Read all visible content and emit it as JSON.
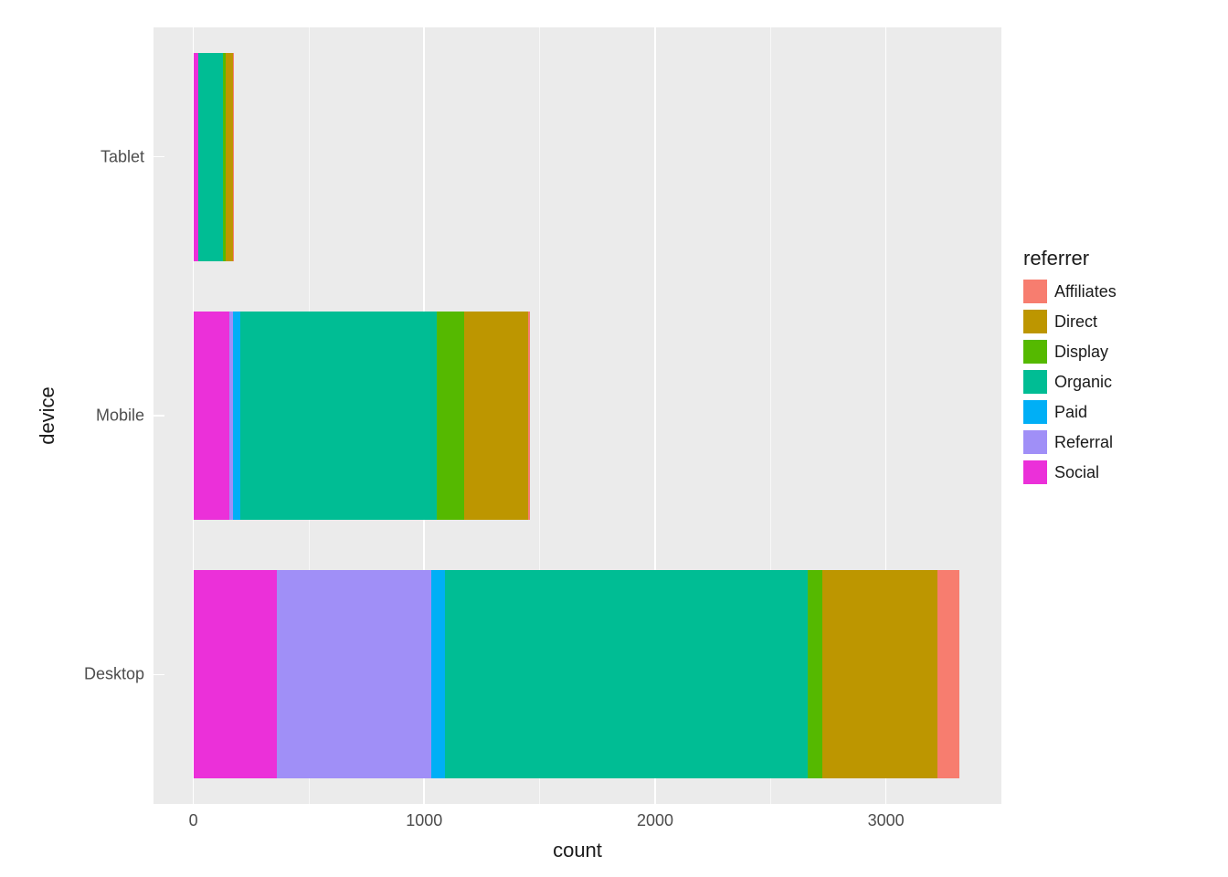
{
  "chart_data": {
    "type": "bar",
    "orientation": "horizontal",
    "stacked": true,
    "categories": [
      "Tablet",
      "Mobile",
      "Desktop"
    ],
    "series": [
      {
        "name": "Social",
        "color": "#EB30D9",
        "values": [
          20,
          155,
          360
        ]
      },
      {
        "name": "Referral",
        "color": "#A08FF7",
        "values": [
          0,
          15,
          670
        ]
      },
      {
        "name": "Paid",
        "color": "#00AFF6",
        "values": [
          0,
          35,
          60
        ]
      },
      {
        "name": "Organic",
        "color": "#00BD94",
        "values": [
          110,
          850,
          1570
        ]
      },
      {
        "name": "Display",
        "color": "#55B900",
        "values": [
          10,
          120,
          65
        ]
      },
      {
        "name": "Direct",
        "color": "#BD9600",
        "values": [
          30,
          275,
          500
        ]
      },
      {
        "name": "Affiliates",
        "color": "#F77D6F",
        "values": [
          5,
          10,
          95
        ]
      }
    ],
    "xlabel": "count",
    "ylabel": "device",
    "xlim": [
      0,
      3500
    ],
    "x_ticks": [
      0,
      1000,
      2000,
      3000
    ],
    "legend_title": "referrer",
    "legend_order": [
      "Affiliates",
      "Direct",
      "Display",
      "Organic",
      "Paid",
      "Referral",
      "Social"
    ]
  }
}
